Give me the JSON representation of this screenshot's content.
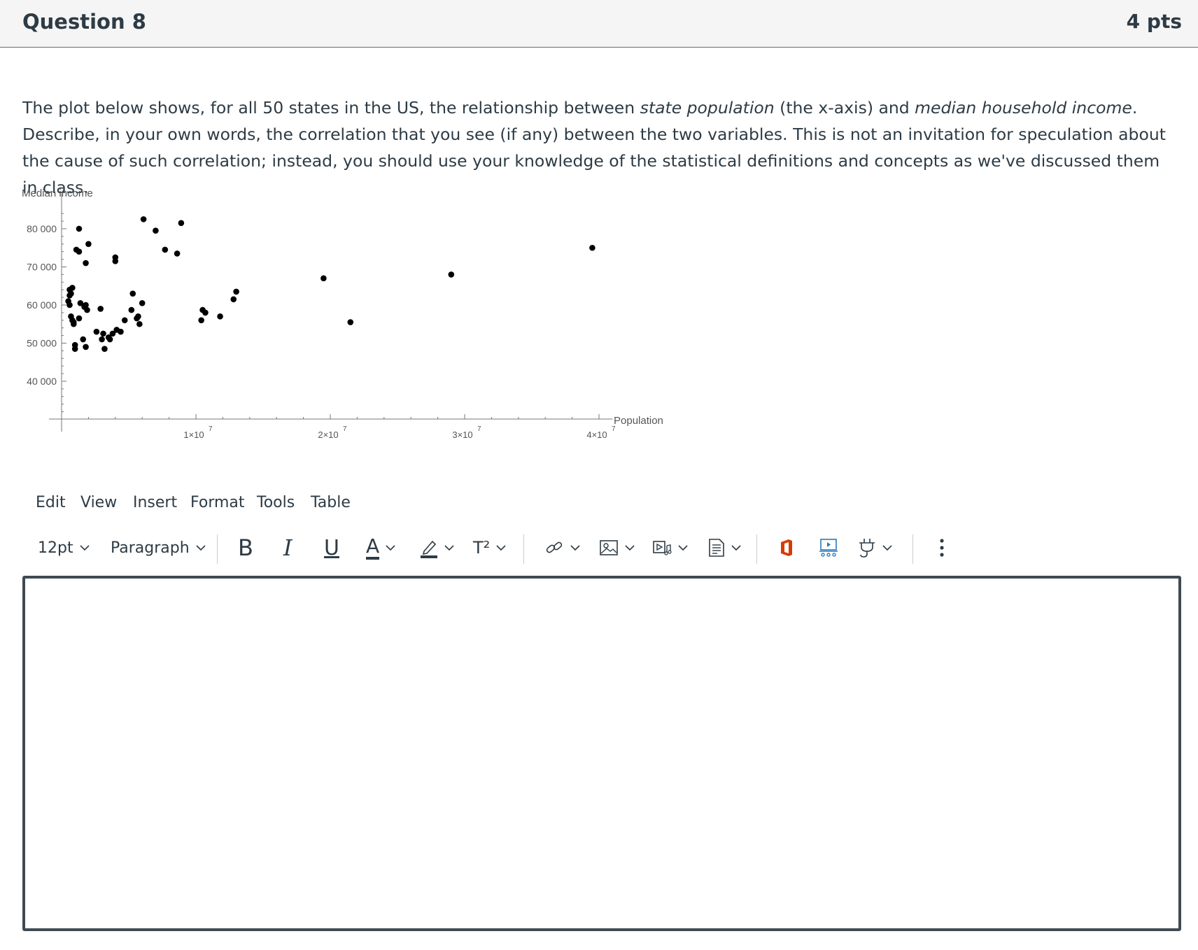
{
  "question": {
    "title": "Question 8",
    "points": "4 pts"
  },
  "prompt": {
    "p1": "The plot below shows, for all 50 states in the US, the relationship between ",
    "em1": "state population",
    "p2": " (the x-axis) and ",
    "em2": "median household income",
    "p3": ". Describe, in your own words, the correlation that you see (if any) between the two variables. This is not an invitation for speculation about the cause of such correlation; instead, you should use your knowledge of the statistical definitions and concepts as we've discussed them in class."
  },
  "chart_data": {
    "type": "scatter",
    "ylabel": "Median income",
    "xlabel": "Population",
    "ylim": [
      30000,
      85000
    ],
    "xlim": [
      0,
      41000000
    ],
    "yticks": [
      {
        "value": 40000,
        "label": "40 000"
      },
      {
        "value": 50000,
        "label": "50 000"
      },
      {
        "value": 60000,
        "label": "60 000"
      },
      {
        "value": 70000,
        "label": "70 000"
      },
      {
        "value": 80000,
        "label": "80 000"
      }
    ],
    "xticks": [
      {
        "value": 10000000,
        "base": "1×10",
        "exp": "7"
      },
      {
        "value": 20000000,
        "base": "2×10",
        "exp": "7"
      },
      {
        "value": 30000000,
        "base": "3×10",
        "exp": "7"
      },
      {
        "value": 40000000,
        "base": "4×10",
        "exp": "7"
      }
    ],
    "points": [
      {
        "x": 39500000,
        "y": 75000
      },
      {
        "x": 29000000,
        "y": 68000
      },
      {
        "x": 21500000,
        "y": 55500
      },
      {
        "x": 19500000,
        "y": 67000
      },
      {
        "x": 13000000,
        "y": 63500
      },
      {
        "x": 12800000,
        "y": 61500
      },
      {
        "x": 11800000,
        "y": 57000
      },
      {
        "x": 10700000,
        "y": 58000
      },
      {
        "x": 10400000,
        "y": 56000
      },
      {
        "x": 10500000,
        "y": 58700
      },
      {
        "x": 8900000,
        "y": 81500
      },
      {
        "x": 8600000,
        "y": 73500
      },
      {
        "x": 7700000,
        "y": 74500
      },
      {
        "x": 7000000,
        "y": 79500
      },
      {
        "x": 6100000,
        "y": 82500
      },
      {
        "x": 6000000,
        "y": 60500
      },
      {
        "x": 5800000,
        "y": 55000
      },
      {
        "x": 5700000,
        "y": 57000
      },
      {
        "x": 5600000,
        "y": 56500
      },
      {
        "x": 5300000,
        "y": 63000
      },
      {
        "x": 5200000,
        "y": 58700
      },
      {
        "x": 4700000,
        "y": 56000
      },
      {
        "x": 4400000,
        "y": 53000
      },
      {
        "x": 4100000,
        "y": 53500
      },
      {
        "x": 4000000,
        "y": 71500
      },
      {
        "x": 4000000,
        "y": 72500
      },
      {
        "x": 3800000,
        "y": 52500
      },
      {
        "x": 3600000,
        "y": 51000
      },
      {
        "x": 3500000,
        "y": 51500
      },
      {
        "x": 3200000,
        "y": 48500
      },
      {
        "x": 3100000,
        "y": 52500
      },
      {
        "x": 3000000,
        "y": 51000
      },
      {
        "x": 2900000,
        "y": 59000
      },
      {
        "x": 2600000,
        "y": 53000
      },
      {
        "x": 2000000,
        "y": 76000
      },
      {
        "x": 1800000,
        "y": 71000
      },
      {
        "x": 1900000,
        "y": 58700
      },
      {
        "x": 1800000,
        "y": 60000
      },
      {
        "x": 1700000,
        "y": 59500
      },
      {
        "x": 1800000,
        "y": 49000
      },
      {
        "x": 1600000,
        "y": 51000
      },
      {
        "x": 1400000,
        "y": 60500
      },
      {
        "x": 1300000,
        "y": 56500
      },
      {
        "x": 1000000,
        "y": 49500
      },
      {
        "x": 1300000,
        "y": 80000
      },
      {
        "x": 1100000,
        "y": 74500
      },
      {
        "x": 1300000,
        "y": 74000
      },
      {
        "x": 1000000,
        "y": 48500
      },
      {
        "x": 900000,
        "y": 55000
      },
      {
        "x": 700000,
        "y": 57000
      },
      {
        "x": 600000,
        "y": 64000
      },
      {
        "x": 800000,
        "y": 64500
      },
      {
        "x": 600000,
        "y": 62500
      },
      {
        "x": 700000,
        "y": 63000
      },
      {
        "x": 800000,
        "y": 56000
      },
      {
        "x": 900000,
        "y": 55500
      },
      {
        "x": 600000,
        "y": 60000
      },
      {
        "x": 500000,
        "y": 61000
      }
    ]
  },
  "editor": {
    "menu": [
      "Edit",
      "View",
      "Insert",
      "Format",
      "Tools",
      "Table"
    ],
    "font_size": "12pt",
    "block_format": "Paragraph",
    "bold": "B",
    "italic": "I",
    "underline": "U",
    "text_color": "A",
    "superscript": "T²",
    "icons": [
      "chevron-down-icon",
      "pencil-icon",
      "link-icon",
      "image-icon",
      "media-icon",
      "document-icon",
      "office-icon",
      "embed-icon",
      "plug-icon",
      "more-icon"
    ],
    "colors": {
      "office": "#d83b01",
      "embed": "#2b7abc"
    }
  }
}
